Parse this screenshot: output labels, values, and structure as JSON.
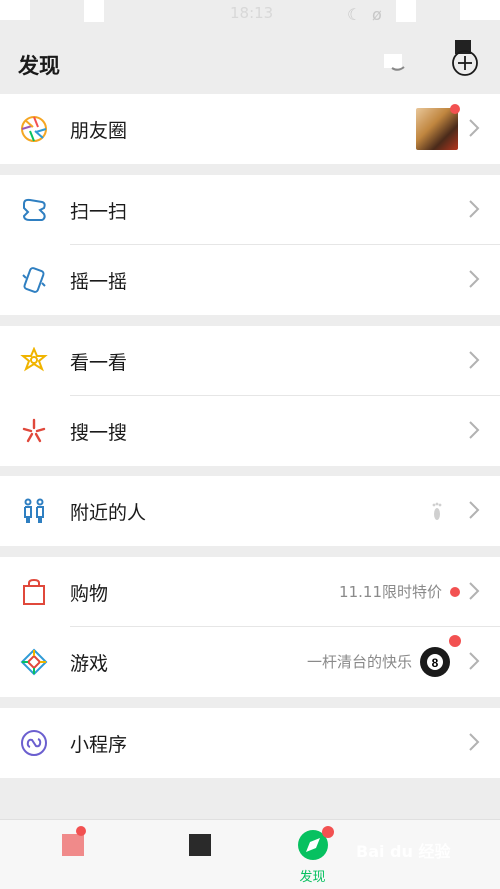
{
  "status_bar": {
    "time": "18:13"
  },
  "header": {
    "title": "发现"
  },
  "rows": {
    "moments": {
      "label": "朋友圈"
    },
    "scan": {
      "label": "扫一扫"
    },
    "shake": {
      "label": "摇一摇"
    },
    "top_stories": {
      "label": "看一看"
    },
    "search": {
      "label": "搜一搜"
    },
    "nearby": {
      "label": "附近的人"
    },
    "shopping": {
      "label": "购物",
      "aux": "11.11限时特价"
    },
    "games": {
      "label": "游戏",
      "aux": "一杆清台的快乐"
    },
    "mini_programs": {
      "label": "小程序"
    }
  },
  "tabbar": {
    "discover_label": "发现"
  },
  "watermark": "Bai du 经验",
  "colors": {
    "accent_green": "#07c160",
    "badge_red": "#f25151",
    "background": "#ededed"
  },
  "icons": {
    "moments": "aperture-icon",
    "scan": "scan-icon",
    "shake": "shake-phone-icon",
    "top_stories": "star-icon",
    "search": "search-star-icon",
    "nearby": "people-icon",
    "shopping": "shopping-bag-icon",
    "games": "game-diamond-icon",
    "mini_programs": "mini-program-icon"
  }
}
